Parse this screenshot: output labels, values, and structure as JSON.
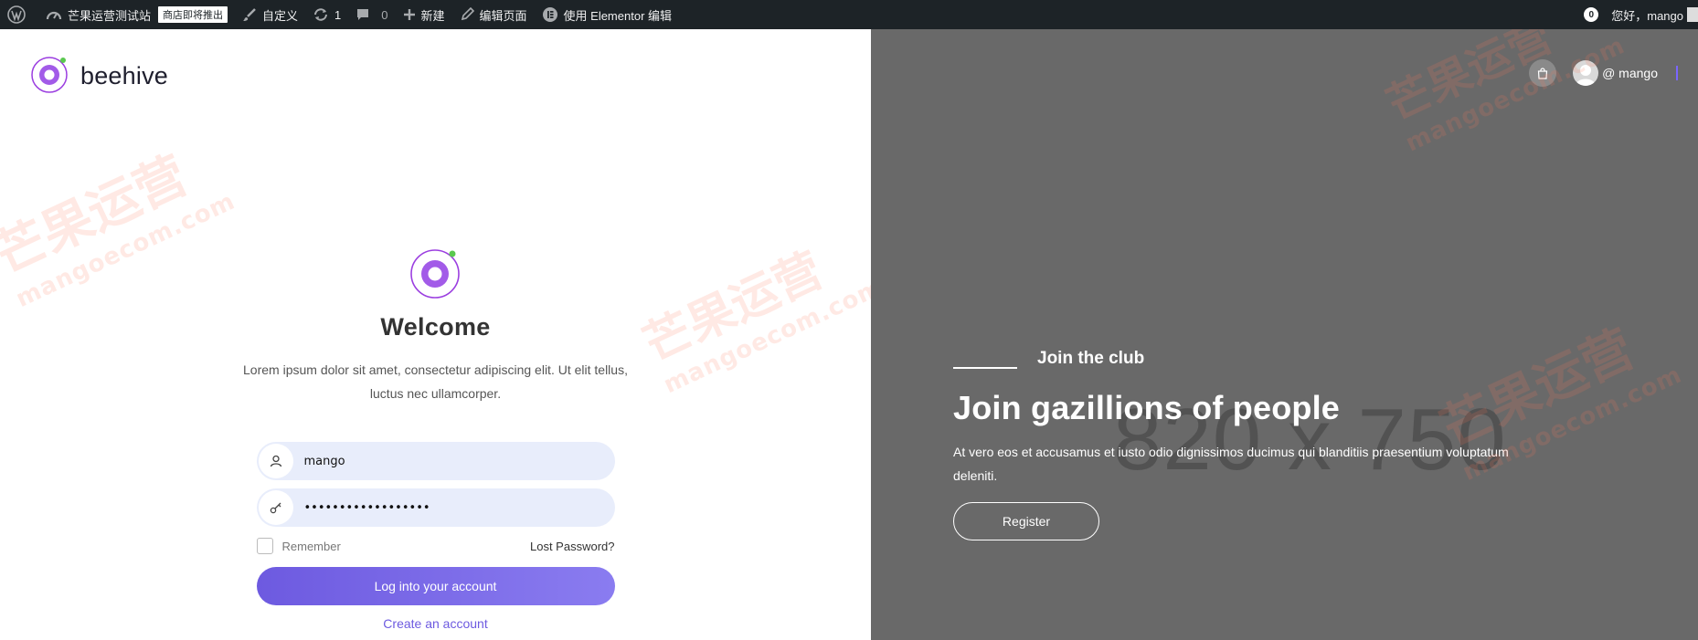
{
  "adminbar": {
    "site_name": "芒果运营测试站",
    "site_badge": "商店即将推出",
    "customize": "自定义",
    "updates_count": "1",
    "comments_count": "0",
    "new": "新建",
    "edit_page": "编辑页面",
    "elementor_edit": "使用 Elementor 编辑",
    "notifications_count": "0",
    "greeting": "您好，mango"
  },
  "brand": {
    "name": "beehive",
    "accent": "#9b3ee0"
  },
  "login": {
    "title": "Welcome",
    "intro": "Lorem ipsum dolor sit amet, consectetur adipiscing elit. Ut elit tellus, luctus nec ullamcorper.",
    "username_value": "mango",
    "password_value": "••••••••••••••••••",
    "remember_label": "Remember",
    "lost_password_label": "Lost Password?",
    "login_button": "Log into your account",
    "create_account": "Create an account"
  },
  "right": {
    "user_label": "@ mango",
    "placeholder_text": "820 x 750",
    "club_tag": "Join the club",
    "club_title": "Join gazillions of people",
    "club_text": "At vero eos et accusamus et iusto odio dignissimos ducimus qui blanditiis praesentium voluptatum deleniti.",
    "register_button": "Register"
  },
  "watermark": {
    "cn": "芒果运营",
    "en": "mangoecom.com"
  },
  "colors": {
    "adminbar": "#1d2327",
    "primary": "#6d5ae0",
    "panel_gray": "#696969",
    "field_bg": "#e8edfb"
  }
}
